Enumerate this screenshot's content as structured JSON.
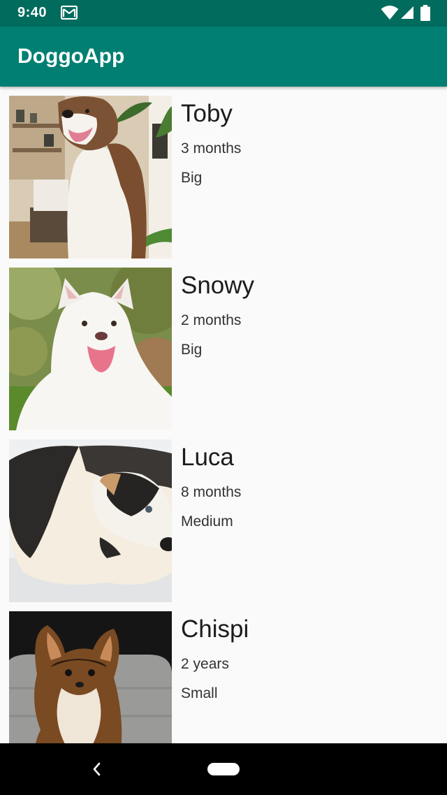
{
  "status_bar": {
    "time": "9:40",
    "icons": [
      "gmail-icon",
      "wifi-icon",
      "signal-icon",
      "battery-icon"
    ]
  },
  "app_bar": {
    "title": "DoggoApp",
    "color": "#017F72"
  },
  "dogs": [
    {
      "name": "Toby",
      "age": "3 months",
      "size": "Big",
      "photo": "husky"
    },
    {
      "name": "Snowy",
      "age": "2 months",
      "size": "Big",
      "photo": "white-fluffy-dog"
    },
    {
      "name": "Luca",
      "age": "8 months",
      "size": "Medium",
      "photo": "black-white-dog"
    },
    {
      "name": "Chispi",
      "age": "2 years",
      "size": "Small",
      "photo": "chihuahua"
    }
  ],
  "nav_bar": {
    "icons": [
      "back-icon",
      "home-pill-icon"
    ]
  }
}
